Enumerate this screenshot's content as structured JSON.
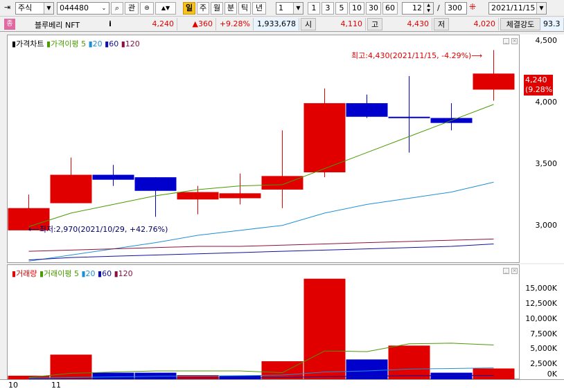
{
  "toolbar": {
    "market_type": "주식",
    "stock_code": "044480",
    "btn_gwan": "관",
    "period_tabs": [
      "일",
      "주",
      "월",
      "분",
      "틱",
      "년"
    ],
    "active_period": "일",
    "interval_value": "1",
    "quick_intervals": [
      "1",
      "3",
      "5",
      "10",
      "30",
      "60"
    ],
    "count_value": "12",
    "count_separator": "/",
    "count_total": "300",
    "date_value": "2021/11/15"
  },
  "quote": {
    "badge": "종",
    "name": "블루베리 NFT",
    "info_icon": "i",
    "price": "4,240",
    "change": "▲360",
    "change_pct": "+9.28%",
    "volume": "1,933,678",
    "open_label": "시",
    "open": "4,110",
    "high_label": "고",
    "high": "4,430",
    "low_label": "저",
    "low": "4,020",
    "strength_label": "체결강도",
    "strength": "93.3"
  },
  "price_panel": {
    "legend_title": "가격차트",
    "legend_ma_label": "가격이평",
    "ma_periods": [
      "5",
      "20",
      "60",
      "120"
    ],
    "high_annotation": "최고:4,430(2021/11/15, -4.29%)",
    "low_annotation": "최저:2,970(2021/10/29, +42.76%)",
    "current_price_box": "4,240",
    "current_pct_box": "(9.28%)"
  },
  "volume_panel": {
    "legend_title": "거래량",
    "legend_ma_label": "거래이평",
    "ma_periods": [
      "5",
      "20",
      "60",
      "120"
    ]
  },
  "x_axis_labels": [
    "10",
    "11"
  ],
  "colors": {
    "up": "#e00000",
    "down": "#0000cc",
    "ma5": "#4a9a00",
    "ma20": "#1e8fd6",
    "ma60": "#1010a0",
    "ma120": "#8a1040"
  },
  "chart_data": [
    {
      "type": "candlestick",
      "title": "가격차트",
      "y_ticks": [
        3000,
        3500,
        4000,
        4500
      ],
      "y_tick_labels": [
        "3,000",
        "3,500",
        "4,000",
        "4,500"
      ],
      "ylim": [
        2700,
        4550
      ],
      "candles": [
        {
          "o": 2970,
          "h": 3260,
          "l": 2970,
          "c": 3150
        },
        {
          "o": 3190,
          "h": 3560,
          "l": 3190,
          "c": 3420
        },
        {
          "o": 3420,
          "h": 3500,
          "l": 3330,
          "c": 3380
        },
        {
          "o": 3400,
          "h": 3400,
          "l": 3080,
          "c": 3290
        },
        {
          "o": 3220,
          "h": 3330,
          "l": 3100,
          "c": 3280
        },
        {
          "o": 3230,
          "h": 3430,
          "l": 3180,
          "c": 3270
        },
        {
          "o": 3300,
          "h": 3780,
          "l": 3150,
          "c": 3410
        },
        {
          "o": 3440,
          "h": 4120,
          "l": 3400,
          "c": 4000
        },
        {
          "o": 4000,
          "h": 4070,
          "l": 3880,
          "c": 3890
        },
        {
          "o": 3890,
          "h": 4220,
          "l": 3600,
          "c": 3880
        },
        {
          "o": 3880,
          "h": 4000,
          "l": 3780,
          "c": 3840
        },
        {
          "o": 4110,
          "h": 4430,
          "l": 4020,
          "c": 4240
        }
      ],
      "ma5": [
        3000,
        3110,
        3180,
        3250,
        3300,
        3330,
        3340,
        3470,
        3600,
        3730,
        3860,
        3990
      ],
      "ma20": [
        2720,
        2770,
        2820,
        2870,
        2930,
        2970,
        3010,
        3110,
        3180,
        3230,
        3280,
        3360
      ],
      "ma60": [
        2730,
        2750,
        2760,
        2770,
        2780,
        2790,
        2800,
        2810,
        2820,
        2830,
        2840,
        2860
      ],
      "ma120": [
        2800,
        2810,
        2820,
        2830,
        2840,
        2840,
        2850,
        2860,
        2870,
        2880,
        2890,
        2900
      ]
    },
    {
      "type": "bar",
      "title": "거래량",
      "y_ticks": [
        0,
        2500,
        5000,
        7500,
        10000,
        12500,
        15000
      ],
      "y_tick_labels": [
        "0K",
        "2,500K",
        "5,000K",
        "7,500K",
        "10,000K",
        "12,500K",
        "15,000K"
      ],
      "ylim": [
        0,
        17000
      ],
      "values": [
        700,
        4200,
        1200,
        1200,
        800,
        700,
        3100,
        16800,
        3400,
        5700,
        1200,
        1900
      ],
      "directions": [
        "up",
        "up",
        "down",
        "down",
        "up",
        "down",
        "up",
        "up",
        "down",
        "up",
        "down",
        "up"
      ],
      "ma5": [
        400,
        1100,
        1300,
        1500,
        1500,
        1500,
        1200,
        4800,
        4700,
        6000,
        6100,
        5800
      ],
      "ma20": [
        300,
        400,
        500,
        600,
        650,
        700,
        800,
        1300,
        1500,
        1800,
        1900,
        2000
      ],
      "ma60": [
        200,
        250,
        300,
        300,
        350,
        350,
        400,
        550,
        600,
        700,
        720,
        750
      ]
    }
  ]
}
